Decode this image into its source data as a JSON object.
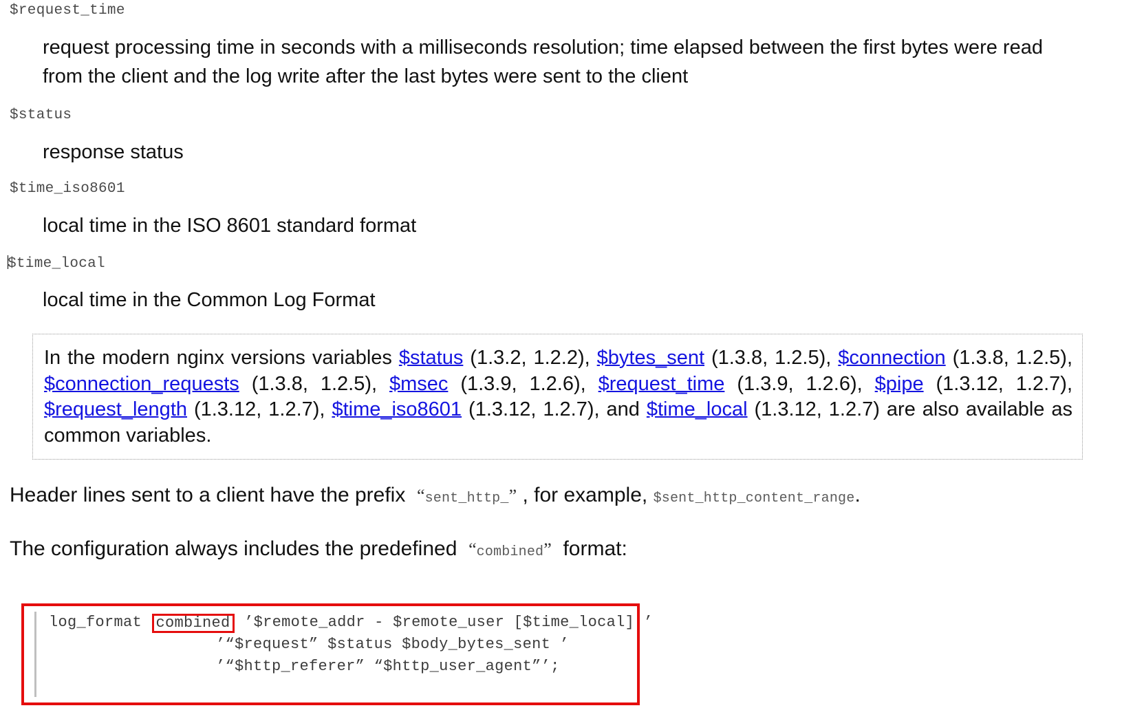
{
  "document": {
    "definitions": [
      {
        "term": "$request_time",
        "description": "request processing time in seconds with a milliseconds resolution; time elapsed between the first bytes were read from the client and the log write after the last bytes were sent to the client"
      },
      {
        "term": "$status",
        "description": "response status"
      },
      {
        "term": "$time_iso8601",
        "description": "local time in the ISO 8601 standard format"
      },
      {
        "term": "$time_local",
        "description": "local time in the Common Log Format",
        "has_caret": true
      }
    ],
    "note": {
      "lead": "In the modern nginx versions variables ",
      "segments": [
        {
          "link": "$status",
          "after": " (1.3.2, 1.2.2), "
        },
        {
          "link": "$bytes_sent",
          "after": " (1.3.8, 1.2.5), "
        },
        {
          "link": "$connection",
          "after": " (1.3.8, 1.2.5), "
        },
        {
          "link": "$connection_requests",
          "after": " (1.3.8, 1.2.5), "
        },
        {
          "link": "$msec",
          "after": " (1.3.9, 1.2.6), "
        },
        {
          "link": "$request_time",
          "after": " (1.3.9, 1.2.6), "
        },
        {
          "link": "$pipe",
          "after": " (1.3.12, 1.2.7), "
        },
        {
          "link": "$request_length",
          "after": " (1.3.12, 1.2.7), "
        },
        {
          "link": "$time_iso8601",
          "after": " (1.3.12, 1.2.7), and "
        },
        {
          "link": "$time_local",
          "after": " (1.3.12, 1.2.7) are also available as common variables."
        }
      ]
    },
    "paragraphs": {
      "header_lines": {
        "part1": "Header lines sent to a client have the prefix",
        "open_quote": "“",
        "code1": "sent_http_",
        "close_quote": "”",
        "part2": ", for example,",
        "code2": "$sent_http_content_range",
        "part3": "."
      },
      "predefined": {
        "part1": "The configuration always includes the predefined",
        "open_quote": "“",
        "code1": "combined",
        "close_quote": "”",
        "part2": "format:"
      }
    },
    "code_block": {
      "line1_prefix": "log_format ",
      "line1_highlight": "combined",
      "line1_suffix": " ’$remote_addr - $remote_user [$time_local] ’",
      "line2": "                  ’“$request” $status $body_bytes_sent ’",
      "line3": "                  ’“$http_referer” “$http_user_agent”’;"
    },
    "colors": {
      "link": "#1414e0",
      "highlight_border": "#e50d0d",
      "code_text": "#3c3c3c",
      "term_text": "#4a4a4a",
      "note_border": "#9a9a9a",
      "code_bar": "#bfbfbf"
    }
  }
}
